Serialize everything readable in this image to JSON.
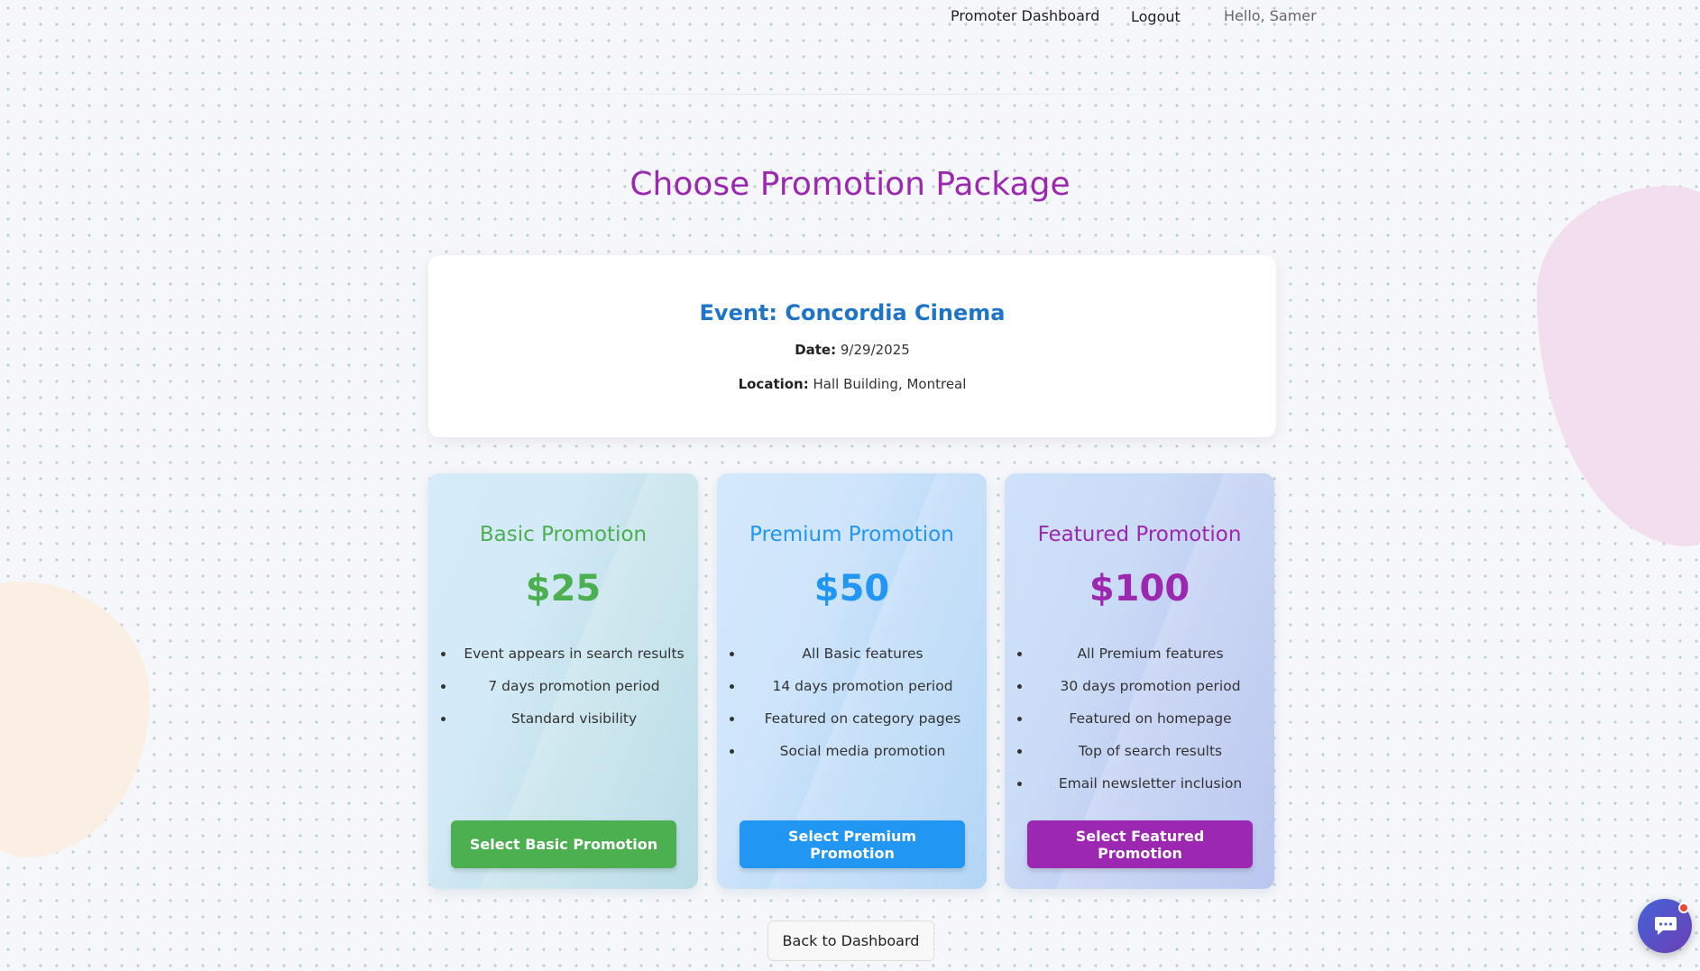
{
  "nav": {
    "dashboard": "Promoter Dashboard",
    "logout": "Logout",
    "greeting": "Hello, Samer"
  },
  "page": {
    "title": "Choose Promotion Package"
  },
  "event": {
    "title": "Event: Concordia Cinema",
    "date_label": "Date:",
    "date": "9/29/2025",
    "location_label": "Location:",
    "location": "Hall Building, Montreal"
  },
  "packages": [
    {
      "name": "Basic Promotion",
      "price": "$25",
      "features": [
        "Event appears in search results",
        "7 days promotion period",
        "Standard visibility"
      ],
      "button_label": "Select Basic Promotion",
      "color": "#4caf50"
    },
    {
      "name": "Premium Promotion",
      "price": "$50",
      "features": [
        "All Basic features",
        "14 days promotion period",
        "Featured on category pages",
        "Social media promotion"
      ],
      "button_label": "Select Premium Promotion",
      "color": "#2196f3"
    },
    {
      "name": "Featured Promotion",
      "price": "$100",
      "features": [
        "All Premium features",
        "30 days promotion period",
        "Featured on homepage",
        "Top of search results",
        "Email newsletter inclusion"
      ],
      "button_label": "Select Featured Promotion",
      "color": "#9c27b0"
    }
  ],
  "footer": {
    "back_label": "Back to Dashboard"
  },
  "chat": {
    "icon": "chat-bubble-icon",
    "badge_color": "#f44336"
  },
  "theme": {
    "title_color": "#9c27b0",
    "event_title_color": "#1e74c8"
  }
}
